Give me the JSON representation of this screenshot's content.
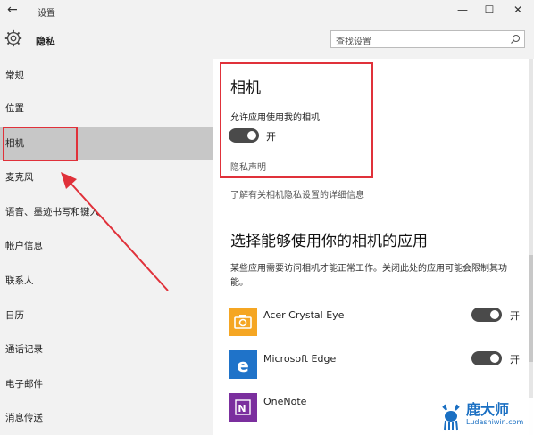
{
  "window": {
    "title": "设置",
    "back_icon": "back-arrow-icon",
    "minimize_glyph": "—",
    "maximize_glyph": "☐",
    "close_glyph": "✕"
  },
  "header": {
    "page_title": "隐私",
    "search_placeholder": "查找设置"
  },
  "sidebar": {
    "items": [
      {
        "label": "常规"
      },
      {
        "label": "位置"
      },
      {
        "label": "相机",
        "selected": true
      },
      {
        "label": "麦克风"
      },
      {
        "label": "语音、墨迹书写和键入"
      },
      {
        "label": "帐户信息"
      },
      {
        "label": "联系人"
      },
      {
        "label": "日历"
      },
      {
        "label": "通话记录"
      },
      {
        "label": "电子邮件"
      },
      {
        "label": "消息传送"
      }
    ]
  },
  "main": {
    "section_title": "相机",
    "allow_label": "允许应用使用我的相机",
    "master_toggle_state": "开",
    "privacy_statement": "隐私声明",
    "learn_more": "了解有关相机隐私设置的详细信息",
    "apps_title": "选择能够使用你的相机的应用",
    "apps_description": "某些应用需要访问相机才能正常工作。关闭此处的应用可能会限制其功能。",
    "apps": [
      {
        "name": "Acer Crystal Eye",
        "toggle_state": "开",
        "on": true,
        "icon": "acer-crystal-eye-icon",
        "color": "#f5a623"
      },
      {
        "name": "Microsoft Edge",
        "toggle_state": "开",
        "on": true,
        "icon": "microsoft-edge-icon",
        "color": "#1f73c9"
      },
      {
        "name": "OneNote",
        "icon": "onenote-icon",
        "color": "#7b2f9e"
      }
    ]
  },
  "annotations": {
    "highlight_color": "#e0313a"
  },
  "watermark": {
    "name": "鹿大师",
    "url": "Ludashiwin.com"
  }
}
